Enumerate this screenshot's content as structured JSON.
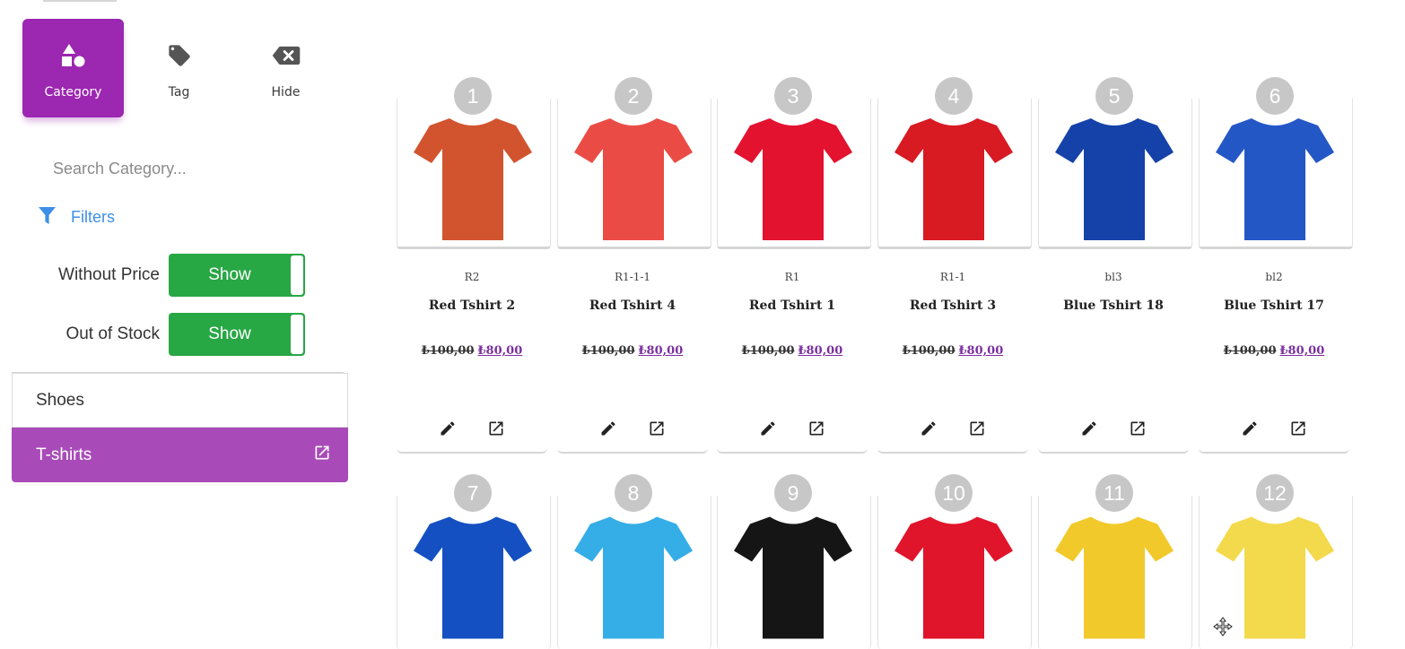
{
  "modes": [
    {
      "label": "Category",
      "icon": "shapes-icon",
      "active": true
    },
    {
      "label": "Tag",
      "icon": "tag-icon",
      "active": false
    },
    {
      "label": "Hide",
      "icon": "backspace-icon",
      "active": false
    }
  ],
  "search": {
    "placeholder": "Search Category..."
  },
  "filters": {
    "label": "Filters",
    "icon": "filter-icon"
  },
  "toggles": [
    {
      "label": "Without Price",
      "value": "Show"
    },
    {
      "label": "Out of Stock",
      "value": "Show"
    }
  ],
  "categories": [
    {
      "label": "Shoes",
      "active": false
    },
    {
      "label": "T-shirts",
      "active": true,
      "icon": "open-in-new-icon"
    }
  ],
  "colors": {
    "accent": "#9c27b0",
    "toggle_green": "#28a745",
    "filter_blue": "#3d8fe6",
    "price_link": "#7b2fa3"
  },
  "products": [
    {
      "index": "1",
      "sku": "R2",
      "name": "Red Tshirt 2",
      "old_price": "₺100,00",
      "new_price": "₺80,00",
      "color": "#d2542f"
    },
    {
      "index": "2",
      "sku": "R1-1-1",
      "name": "Red Tshirt 4",
      "old_price": "₺100,00",
      "new_price": "₺80,00",
      "color": "#ea4c45"
    },
    {
      "index": "3",
      "sku": "R1",
      "name": "Red Tshirt 1",
      "old_price": "₺100,00",
      "new_price": "₺80,00",
      "color": "#e3122e"
    },
    {
      "index": "4",
      "sku": "R1-1",
      "name": "Red Tshirt 3",
      "old_price": "₺100,00",
      "new_price": "₺80,00",
      "color": "#d81a22"
    },
    {
      "index": "5",
      "sku": "bl3",
      "name": "Blue Tshirt 18",
      "old_price": "",
      "new_price": "",
      "color": "#1542a8"
    },
    {
      "index": "6",
      "sku": "bl2",
      "name": "Blue Tshirt 17",
      "old_price": "₺100,00",
      "new_price": "₺80,00",
      "color": "#2457c6"
    },
    {
      "index": "7",
      "color": "#1450c2"
    },
    {
      "index": "8",
      "color": "#35ade6"
    },
    {
      "index": "9",
      "color": "#151515"
    },
    {
      "index": "10",
      "color": "#e0142a"
    },
    {
      "index": "11",
      "color": "#f2c92a"
    },
    {
      "index": "12",
      "color": "#f3d94c"
    }
  ],
  "cursor_icon": "move-cursor-icon"
}
